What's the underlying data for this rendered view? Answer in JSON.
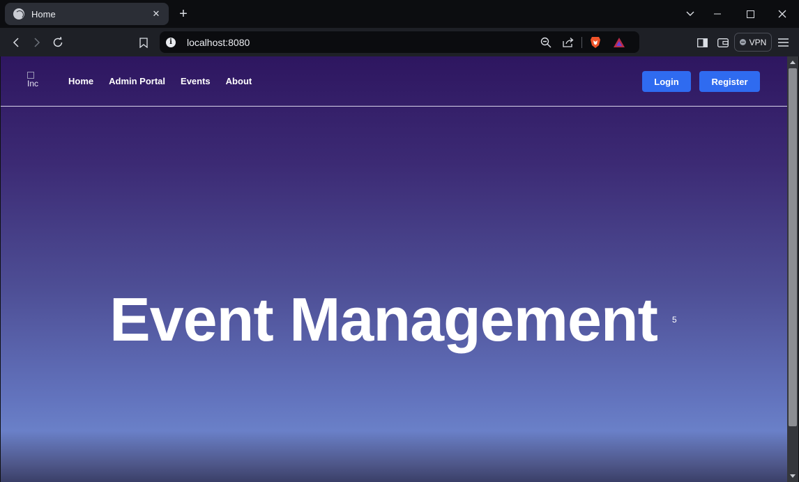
{
  "browser": {
    "tab_title": "Home",
    "tab_close": "✕",
    "new_tab": "+",
    "url": "localhost:8080",
    "vpn_label": "VPN"
  },
  "site": {
    "logo_alt": "Inc",
    "nav": [
      "Home",
      "Admin Portal",
      "Events",
      "About"
    ],
    "login_label": "Login",
    "register_label": "Register"
  },
  "hero": {
    "title": "Event Management",
    "superscript": "5"
  }
}
